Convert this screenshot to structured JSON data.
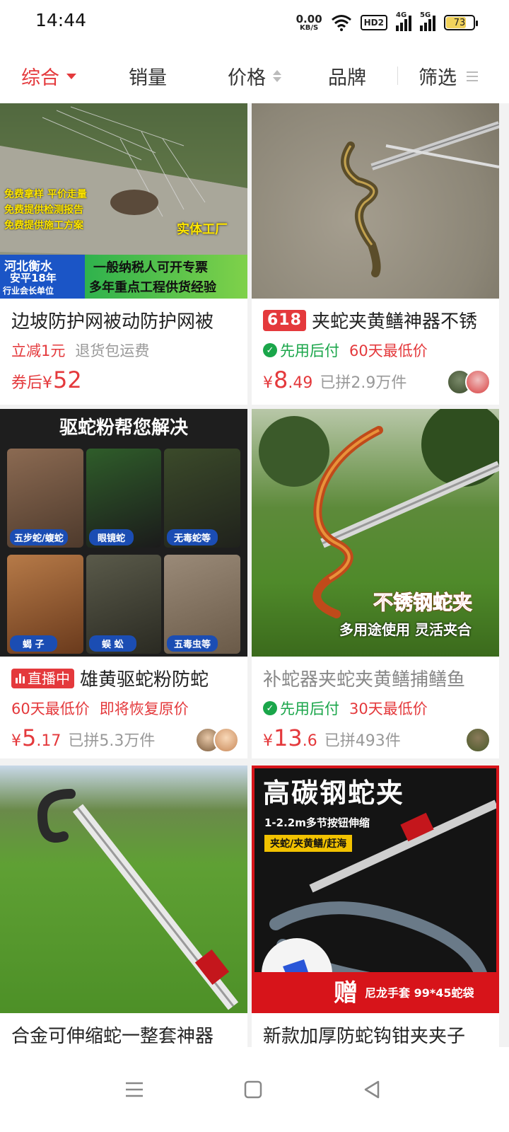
{
  "status": {
    "time": "14:44",
    "net_speed_value": "0.00",
    "net_speed_unit": "KB/S",
    "hd_label": "HD2",
    "sig1_label": "4G",
    "sig2_label": "5G",
    "battery": "73"
  },
  "sort_bar": {
    "items": [
      "综合",
      "销量",
      "价格",
      "品牌",
      "筛选"
    ],
    "active": "综合"
  },
  "products": [
    {
      "title": "边坡防护网被动防护网被",
      "sub_red": "立减1元",
      "sub_grey": "退货包运费",
      "price_prefix": "券后",
      "price_int": "52",
      "image": {
        "lines": [
          "免费拿样 平价走量",
          "免费提供检测报告",
          "免费提供施工方案"
        ],
        "factory": "实体工厂",
        "loc1": "河北衡水",
        "loc2": "安平18年",
        "loc3": "行业会长单位",
        "banner1": "一般纳税人可开专票",
        "banner2": "多年重点工程供货经验"
      }
    },
    {
      "tag": "618",
      "title": "夹蛇夹黄鳝神器不锈",
      "badge": "先用后付",
      "sub_red": "60天最低价",
      "price_int": "8",
      "price_dec": ".49",
      "sold": "已拼2.9万件"
    },
    {
      "tag": "直播中",
      "title": "雄黄驱蛇粉防蛇",
      "sub_red": "60天最低价",
      "sub_red2": "即将恢复原价",
      "price_int": "5",
      "price_dec": ".17",
      "sold": "已拼5.3万件",
      "image": {
        "headline": "驱蛇粉帮您解决",
        "cells": [
          "五步蛇/蝮蛇",
          "眼镜蛇",
          "无毒蛇等",
          "蝎 子",
          "蜈 蚣",
          "五毒虫等"
        ]
      }
    },
    {
      "title": "补蛇器夹蛇夹黄鳝捕鳝鱼",
      "badge": "先用后付",
      "sub_red": "30天最低价",
      "price_int": "13",
      "price_dec": ".6",
      "sold": "已拼493件",
      "image": {
        "line1": "不锈钢蛇夹",
        "line2": "多用途使用 灵活夹合"
      }
    },
    {
      "title": "合金可伸缩蛇一整套神器"
    },
    {
      "title": "新款加厚防蛇钩钳夹夹子",
      "image": {
        "headline": "高碳钢蛇夹",
        "sub": "1-2.2m多节按钮伸缩",
        "tags": "夹蛇/夹黄鳝/赶海",
        "gift": "赠",
        "gift_text": "尼龙手套 99*45蛇袋"
      }
    }
  ]
}
